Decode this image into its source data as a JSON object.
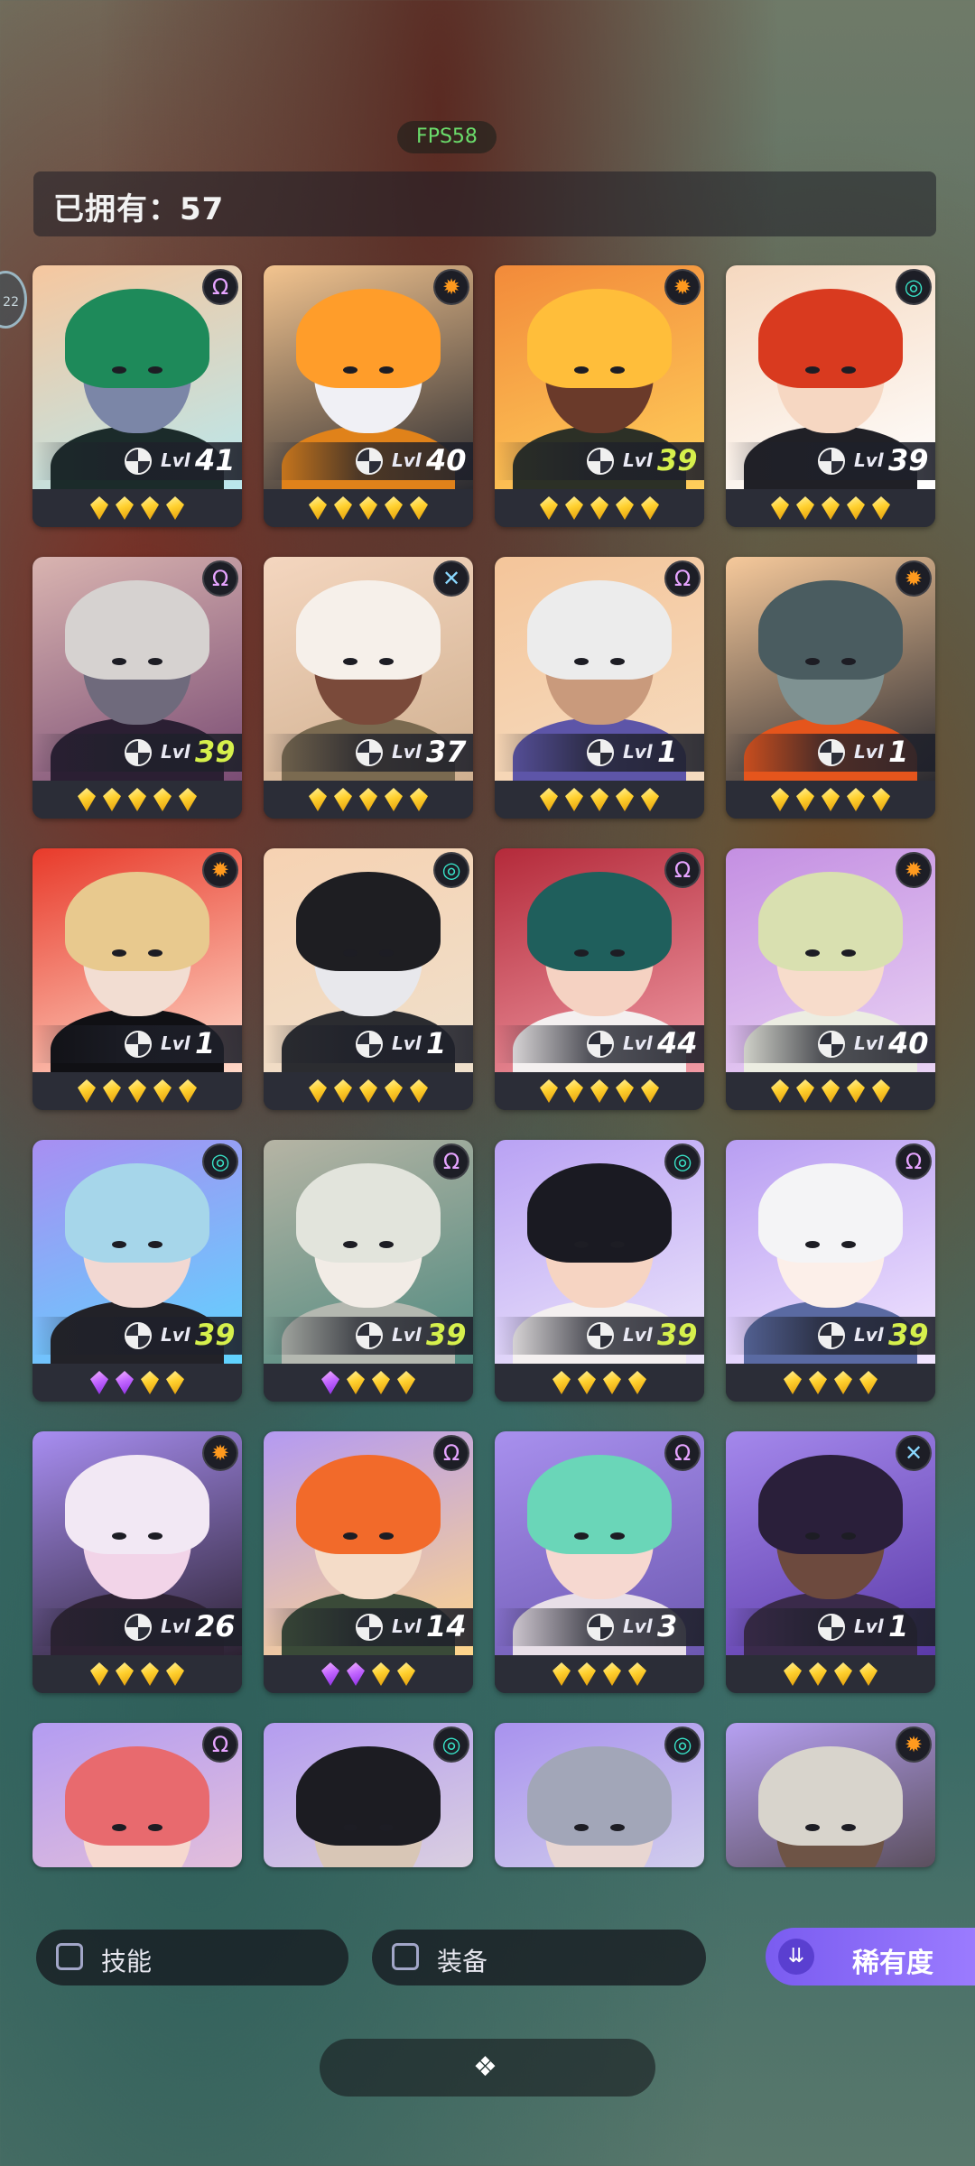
{
  "fps": "FPS58",
  "owned_label": "已拥有：57",
  "side_badge": "22",
  "cards": [
    {
      "level": "41",
      "faction": "omega",
      "lvl_color": "white",
      "gems": [
        "gold",
        "gold",
        "gold",
        "gold"
      ],
      "theme": {
        "bg": "#f6c79f",
        "bg2": "#b9e8ee",
        "hair": "#1e8a5a",
        "skin": "#7b86a7",
        "body": "#1b2b2a"
      }
    },
    {
      "level": "40",
      "faction": "sun",
      "lvl_color": "white",
      "gems": [
        "gold",
        "gold",
        "gold",
        "gold",
        "gold"
      ],
      "theme": {
        "bg": "#f3c48f",
        "bg2": "#2b2b30",
        "hair": "#ff9d2a",
        "skin": "#f0f0f5",
        "body": "#e0821a"
      }
    },
    {
      "level": "39",
      "faction": "sun",
      "lvl_color": "green",
      "gems": [
        "gold",
        "gold",
        "gold",
        "gold",
        "gold"
      ],
      "theme": {
        "bg": "#f28a3a",
        "bg2": "#ffcf5b",
        "hair": "#ffbe3a",
        "skin": "#6a3a2a",
        "body": "#2c3026"
      }
    },
    {
      "level": "39",
      "faction": "spiral",
      "lvl_color": "white",
      "gems": [
        "gold",
        "gold",
        "gold",
        "gold",
        "gold"
      ],
      "theme": {
        "bg": "#f5d8bf",
        "bg2": "#ffffff",
        "hair": "#d93a1f",
        "skin": "#f6d7c2",
        "body": "#202026"
      }
    },
    {
      "level": "39",
      "faction": "omega",
      "lvl_color": "green",
      "gems": [
        "gold",
        "gold",
        "gold",
        "gold",
        "gold"
      ],
      "theme": {
        "bg": "#d9b4b0",
        "bg2": "#7a4c74",
        "hair": "#d6d2d0",
        "skin": "#6f6a7c",
        "body": "#2b1f33"
      }
    },
    {
      "level": "37",
      "faction": "cross",
      "lvl_color": "white",
      "gems": [
        "gold",
        "gold",
        "gold",
        "gold",
        "gold"
      ],
      "theme": {
        "bg": "#f4d6bf",
        "bg2": "#d0b090",
        "hair": "#f6f0ea",
        "skin": "#7a4a3a",
        "body": "#7a6a50"
      }
    },
    {
      "level": "1",
      "faction": "omega",
      "lvl_color": "white",
      "gems": [
        "gold",
        "gold",
        "gold",
        "gold",
        "gold"
      ],
      "theme": {
        "bg": "#f4c59a",
        "bg2": "#f6dcc0",
        "hair": "#ececec",
        "skin": "#c99a7c",
        "body": "#5d55a8"
      }
    },
    {
      "level": "1",
      "faction": "sun",
      "lvl_color": "white",
      "gems": [
        "gold",
        "gold",
        "gold",
        "gold",
        "gold"
      ],
      "theme": {
        "bg": "#f6c99b",
        "bg2": "#2c2b30",
        "hair": "#4a5c60",
        "skin": "#7f9292",
        "body": "#e5551c"
      }
    },
    {
      "level": "1",
      "faction": "sun",
      "lvl_color": "white",
      "gems": [
        "gold",
        "gold",
        "gold",
        "gold",
        "gold"
      ],
      "theme": {
        "bg": "#e83a2a",
        "bg2": "#ffd8c8",
        "hair": "#e8c98e",
        "skin": "#f2ddd2",
        "body": "#101014"
      }
    },
    {
      "level": "1",
      "faction": "spiral",
      "lvl_color": "white",
      "gems": [
        "gold",
        "gold",
        "gold",
        "gold",
        "gold"
      ],
      "theme": {
        "bg": "#f6d2b2",
        "bg2": "#efe0cc",
        "hair": "#1e1e22",
        "skin": "#e8e8ec",
        "body": "#2b2c30"
      }
    },
    {
      "level": "44",
      "faction": "omega",
      "lvl_color": "white",
      "gems": [
        "gold",
        "gold",
        "gold",
        "gold",
        "gold"
      ],
      "theme": {
        "bg": "#b42a3a",
        "bg2": "#f09aa4",
        "hair": "#1f5f5c",
        "skin": "#f5d2c2",
        "body": "#f4f0f0"
      }
    },
    {
      "level": "40",
      "faction": "sun",
      "lvl_color": "white",
      "gems": [
        "gold",
        "gold",
        "gold",
        "gold",
        "gold"
      ],
      "theme": {
        "bg": "#c48fe2",
        "bg2": "#e9d3f4",
        "hair": "#d9e0b0",
        "skin": "#f7dccb",
        "body": "#ecede2"
      }
    },
    {
      "level": "39",
      "faction": "spiral",
      "lvl_color": "green",
      "gems": [
        "purple",
        "purple",
        "gold",
        "gold"
      ],
      "theme": {
        "bg": "#a88ef2",
        "bg2": "#5fd4ff",
        "hair": "#a6d6ea",
        "skin": "#f2d8d2",
        "body": "#222228"
      }
    },
    {
      "level": "39",
      "faction": "omega",
      "lvl_color": "green",
      "gems": [
        "purple",
        "gold",
        "gold",
        "gold"
      ],
      "theme": {
        "bg": "#b6b4a4",
        "bg2": "#4f8a80",
        "hair": "#e2e4dc",
        "skin": "#f2ece6",
        "body": "#b4b8b0"
      }
    },
    {
      "level": "39",
      "faction": "spiral",
      "lvl_color": "green",
      "gems": [
        "gold",
        "gold",
        "gold",
        "gold"
      ],
      "theme": {
        "bg": "#b9a2f4",
        "bg2": "#ede6fb",
        "hair": "#1a1a22",
        "skin": "#f6d4c2",
        "body": "#f4f0f0"
      }
    },
    {
      "level": "39",
      "faction": "omega",
      "lvl_color": "green",
      "gems": [
        "gold",
        "gold",
        "gold",
        "gold"
      ],
      "theme": {
        "bg": "#b89ef2",
        "bg2": "#f2e6ff",
        "hair": "#f4f4f6",
        "skin": "#fcefe9",
        "body": "#5a6aa2"
      }
    },
    {
      "level": "26",
      "faction": "sun",
      "lvl_color": "white",
      "gems": [
        "gold",
        "gold",
        "gold",
        "gold"
      ],
      "theme": {
        "bg": "#a88ef2",
        "bg2": "#2c2232",
        "hair": "#f2e8f4",
        "skin": "#f2d4e8",
        "body": "#2d2233"
      }
    },
    {
      "level": "14",
      "faction": "omega",
      "lvl_color": "white",
      "gems": [
        "purple",
        "purple",
        "gold",
        "gold"
      ],
      "theme": {
        "bg": "#b49af2",
        "bg2": "#ffd68a",
        "hair": "#f26a2a",
        "skin": "#f4dcc8",
        "body": "#3a4a38"
      }
    },
    {
      "level": "3",
      "faction": "omega",
      "lvl_color": "white",
      "gems": [
        "gold",
        "gold",
        "gold",
        "gold"
      ],
      "theme": {
        "bg": "#a890ee",
        "bg2": "#6c58b0",
        "hair": "#6ad6b8",
        "skin": "#f6d8d0",
        "body": "#e8dfe8"
      }
    },
    {
      "level": "1",
      "faction": "cross",
      "lvl_color": "white",
      "gems": [
        "gold",
        "gold",
        "gold",
        "gold"
      ],
      "theme": {
        "bg": "#a488ec",
        "bg2": "#5b3aa8",
        "hair": "#2a1f3a",
        "skin": "#6d4a3e",
        "body": "#3a2a4a"
      }
    },
    {
      "level": "",
      "faction": "omega",
      "lvl_color": "white",
      "gems": [],
      "theme": {
        "bg": "#b39cf2",
        "bg2": "#f4cbd2",
        "hair": "#e86a6e",
        "skin": "#f6d8cf",
        "body": "#8a5a8a"
      }
    },
    {
      "level": "",
      "faction": "spiral",
      "lvl_color": "white",
      "gems": [],
      "theme": {
        "bg": "#b49cf0",
        "bg2": "#e8e2da",
        "hair": "#1c1c22",
        "skin": "#d8c6b6",
        "body": "#2a2a30"
      }
    },
    {
      "level": "",
      "faction": "spiral",
      "lvl_color": "white",
      "gems": [],
      "theme": {
        "bg": "#a892ee",
        "bg2": "#e0e2ec",
        "hair": "#a2a6b8",
        "skin": "#e8d6d2",
        "body": "#b8bcc8"
      }
    },
    {
      "level": "",
      "faction": "sun",
      "lvl_color": "white",
      "gems": [],
      "theme": {
        "bg": "#b6a0f2",
        "bg2": "#3a3228",
        "hair": "#d8d4cc",
        "skin": "#6e5446",
        "body": "#1e1c1a"
      }
    }
  ],
  "lvl_text": "Lvl",
  "faction_glyphs": {
    "omega": "Ω",
    "sun": "✹",
    "spiral": "◎",
    "cross": "✕"
  },
  "filters": {
    "skill": "技能",
    "equip": "装备",
    "rarity": "稀有度",
    "rarity_icon": "double-chevron-down-icon"
  },
  "bottom_handle_icon": "diamond-cluster-icon"
}
